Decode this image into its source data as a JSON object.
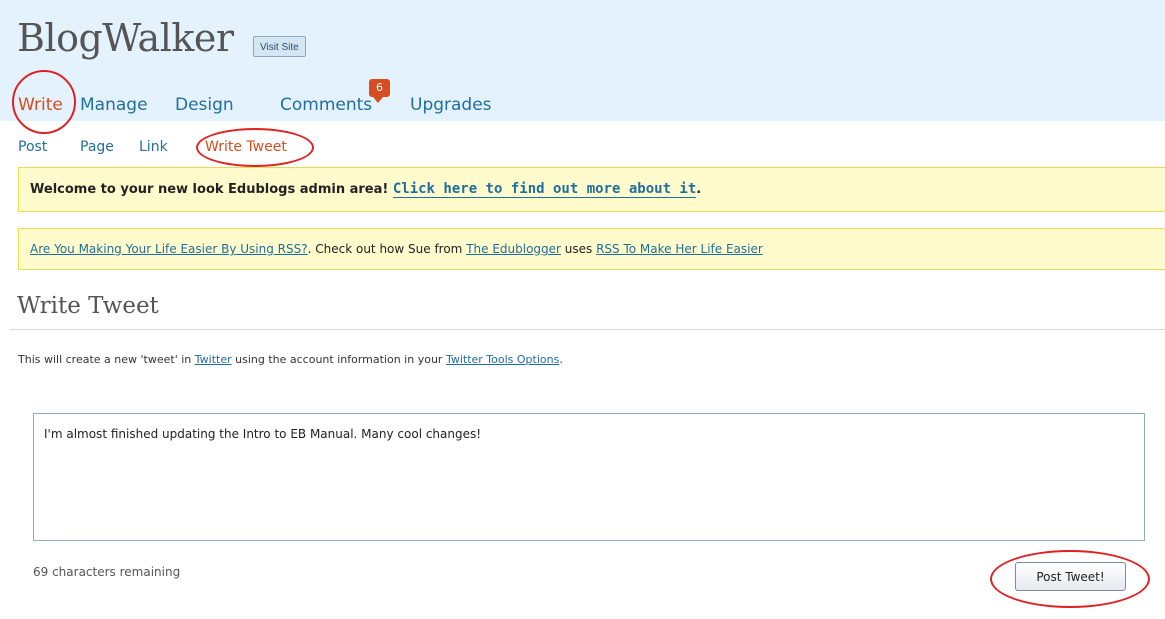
{
  "header": {
    "blog_title": "BlogWalker",
    "visit_site_label": "Visit Site"
  },
  "main_nav": {
    "items": [
      {
        "label": "Write",
        "active": true
      },
      {
        "label": "Manage"
      },
      {
        "label": "Design"
      },
      {
        "label": "Comments",
        "badge": "6"
      },
      {
        "label": "Upgrades"
      }
    ]
  },
  "sub_nav": {
    "items": [
      {
        "label": "Post"
      },
      {
        "label": "Page"
      },
      {
        "label": "Link"
      },
      {
        "label": "Write Tweet",
        "active": true
      }
    ]
  },
  "notices": {
    "welcome": {
      "text": "Welcome to your new look Edublogs admin area! ",
      "link": "Click here to find out more about it",
      "suffix": "."
    },
    "rss": {
      "link1": "Are You Making Your Life Easier By Using RSS?",
      "text1": ". Check out how Sue from ",
      "link2": "The Edublogger",
      "text2": " uses ",
      "link3": "RSS To Make Her Life Easier"
    }
  },
  "page": {
    "heading": "Write Tweet",
    "intro_prefix": "This will create a new 'tweet' in ",
    "intro_link1": "Twitter",
    "intro_middle": " using the account information in your ",
    "intro_link2": "Twitter Tools Options",
    "intro_suffix": "."
  },
  "tweet_form": {
    "value": "I'm almost finished updating the Intro to EB Manual. Many cool changes!",
    "remaining": "69 characters remaining",
    "submit_label": "Post Tweet!"
  },
  "colors": {
    "header_bg": "#e4f2fd",
    "link": "#1f6e9e",
    "active": "#d54e21",
    "notice_bg": "#fffbcc",
    "callout": "#e02121"
  }
}
